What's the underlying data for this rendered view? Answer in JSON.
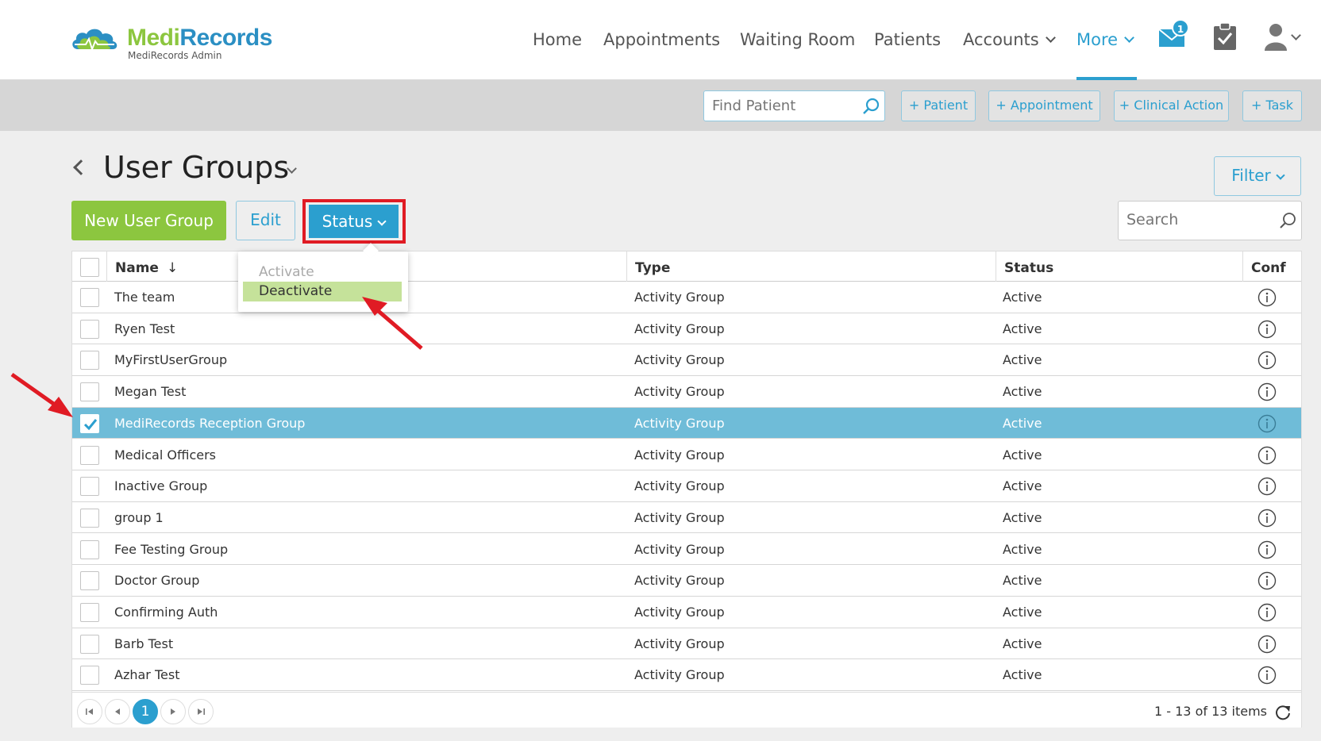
{
  "app": {
    "logo_main_a": "Medi",
    "logo_main_b": "Records",
    "logo_sub": "MediRecords Admin"
  },
  "nav": {
    "home": "Home",
    "appointments": "Appointments",
    "waiting_room": "Waiting Room",
    "patients": "Patients",
    "accounts": "Accounts",
    "more": "More",
    "mail_badge": "1"
  },
  "toolbar": {
    "find_patient_placeholder": "Find Patient",
    "add_patient": "+ Patient",
    "add_appointment": "+ Appointment",
    "add_clinical_action": "+ Clinical Action",
    "add_task": "+ Task"
  },
  "page": {
    "title": "User Groups",
    "filter": "Filter",
    "new_group": "New User Group",
    "edit": "Edit",
    "status": "Status",
    "search_placeholder": "Search"
  },
  "status_menu": {
    "activate": "Activate",
    "deactivate": "Deactivate"
  },
  "table": {
    "columns": {
      "name": "Name",
      "type": "Type",
      "status": "Status",
      "conf": "Conf"
    },
    "sort_indicator": "↓",
    "rows": [
      {
        "name": "The team",
        "type": "Activity Group",
        "status": "Active",
        "selected": false
      },
      {
        "name": "Ryen Test",
        "type": "Activity Group",
        "status": "Active",
        "selected": false
      },
      {
        "name": "MyFirstUserGroup",
        "type": "Activity Group",
        "status": "Active",
        "selected": false
      },
      {
        "name": "Megan Test",
        "type": "Activity Group",
        "status": "Active",
        "selected": false
      },
      {
        "name": "MediRecords Reception Group",
        "type": "Activity Group",
        "status": "Active",
        "selected": true
      },
      {
        "name": "Medical Officers",
        "type": "Activity Group",
        "status": "Active",
        "selected": false
      },
      {
        "name": "Inactive Group",
        "type": "Activity Group",
        "status": "Active",
        "selected": false
      },
      {
        "name": "group 1",
        "type": "Activity Group",
        "status": "Active",
        "selected": false
      },
      {
        "name": "Fee Testing Group",
        "type": "Activity Group",
        "status": "Active",
        "selected": false
      },
      {
        "name": "Doctor Group",
        "type": "Activity Group",
        "status": "Active",
        "selected": false
      },
      {
        "name": "Confirming Auth",
        "type": "Activity Group",
        "status": "Active",
        "selected": false
      },
      {
        "name": "Barb Test",
        "type": "Activity Group",
        "status": "Active",
        "selected": false
      },
      {
        "name": "Azhar Test",
        "type": "Activity Group",
        "status": "Active",
        "selected": false
      }
    ]
  },
  "pager": {
    "current_page": "1",
    "items_summary": "1 - 13 of 13 items"
  },
  "colors": {
    "brand_green": "#8cc63f",
    "brand_blue": "#2b9fcf",
    "selected_row": "#6fbcd8",
    "highlight_red": "#e01b24",
    "menu_hover": "#c5e29a"
  }
}
